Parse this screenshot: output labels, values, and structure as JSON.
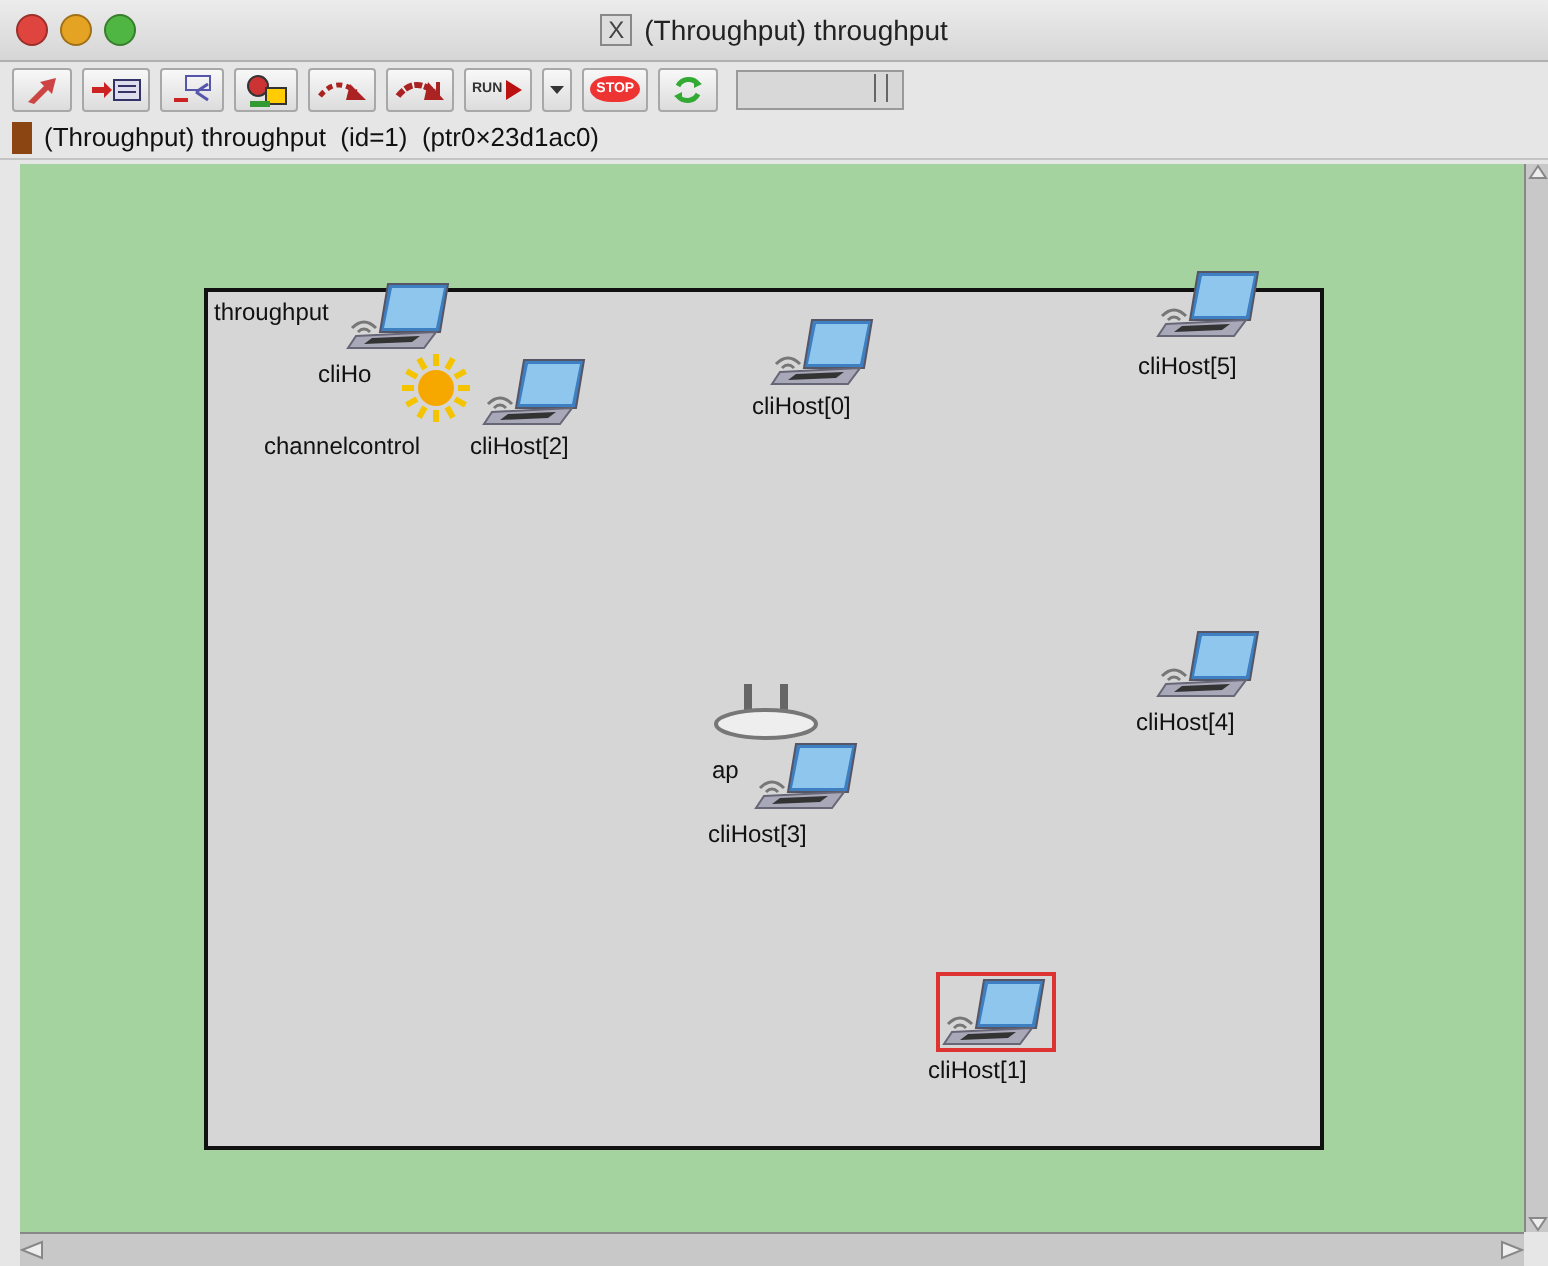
{
  "window": {
    "title": "(Throughput) throughput",
    "title_icon": "X"
  },
  "toolbar": {
    "buttons": [
      {
        "kind": "up"
      },
      {
        "kind": "step-in"
      },
      {
        "kind": "events"
      },
      {
        "kind": "inspect"
      },
      {
        "kind": "step"
      },
      {
        "kind": "fast"
      },
      {
        "kind": "run",
        "label": "RUN"
      },
      {
        "kind": "dropdown"
      },
      {
        "kind": "stop",
        "label": "STOP"
      },
      {
        "kind": "refresh"
      }
    ],
    "speed": {
      "level": 0.88
    }
  },
  "info_bar": {
    "text": "(Throughput) throughput  (id=1)  (ptr0×23d1ac0)"
  },
  "network": {
    "name": "throughput",
    "nodes": [
      {
        "label": "cliHo",
        "kind": "laptop",
        "selected": false
      },
      {
        "label": "channelcontrol",
        "kind": "sun",
        "selected": false
      },
      {
        "label": "cliHost[2]",
        "kind": "laptop",
        "selected": false
      },
      {
        "label": "cliHost[0]",
        "kind": "laptop",
        "selected": false
      },
      {
        "label": "cliHost[5]",
        "kind": "laptop",
        "selected": false
      },
      {
        "label": "cliHost[4]",
        "kind": "laptop",
        "selected": false
      },
      {
        "label": "ap",
        "kind": "router",
        "selected": false
      },
      {
        "label": "cliHost[3]",
        "kind": "laptop",
        "selected": false
      },
      {
        "label": "cliHost[1]",
        "kind": "laptop",
        "selected": true
      }
    ]
  }
}
